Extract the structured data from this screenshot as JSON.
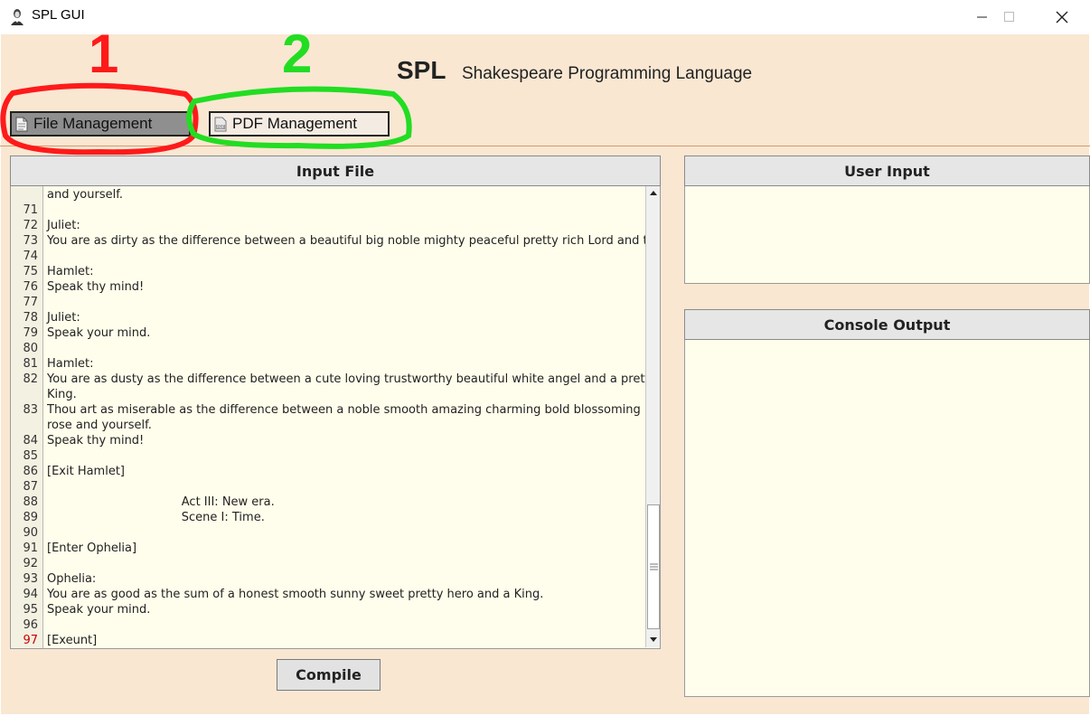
{
  "window": {
    "title": "SPL GUI"
  },
  "header": {
    "logo": "SPL",
    "subtitle": "Shakespeare Programming Language"
  },
  "tabs": [
    {
      "label": "File Management",
      "active": true
    },
    {
      "label": "PDF Management",
      "active": false
    }
  ],
  "annotations": {
    "marker1": "1",
    "marker2": "2",
    "color1": "#ff1a1a",
    "color2": "#22dd22"
  },
  "input_panel": {
    "title": "Input File",
    "lines": [
      {
        "n": "",
        "t": "and yourself."
      },
      {
        "n": "71",
        "t": ""
      },
      {
        "n": "72",
        "t": "Juliet:"
      },
      {
        "n": "73",
        "t": "You are as dirty as the difference between a beautiful big noble mighty peaceful pretty rich Lord and thyself."
      },
      {
        "n": "74",
        "t": ""
      },
      {
        "n": "75",
        "t": "Hamlet:"
      },
      {
        "n": "76",
        "t": "Speak thy mind!"
      },
      {
        "n": "77",
        "t": ""
      },
      {
        "n": "78",
        "t": "Juliet:"
      },
      {
        "n": "79",
        "t": "Speak your mind."
      },
      {
        "n": "80",
        "t": ""
      },
      {
        "n": "81",
        "t": "Hamlet:"
      },
      {
        "n": "82",
        "t": "You are as dusty as the difference between a cute loving trustworthy beautiful white angel and a pretty rich"
      },
      {
        "n": "",
        "t": "King."
      },
      {
        "n": "83",
        "t": "Thou art as miserable as the difference between a noble smooth amazing charming bold blossoming big"
      },
      {
        "n": "",
        "t": "rose and yourself."
      },
      {
        "n": "84",
        "t": "Speak thy mind!"
      },
      {
        "n": "85",
        "t": ""
      },
      {
        "n": "86",
        "t": "[Exit Hamlet]"
      },
      {
        "n": "87",
        "t": ""
      },
      {
        "n": "88",
        "t": "                                    Act III: New era."
      },
      {
        "n": "89",
        "t": "                                    Scene I: Time."
      },
      {
        "n": "90",
        "t": ""
      },
      {
        "n": "91",
        "t": "[Enter Ophelia]"
      },
      {
        "n": "92",
        "t": ""
      },
      {
        "n": "93",
        "t": "Ophelia:"
      },
      {
        "n": "94",
        "t": "You are as good as the sum of a honest smooth sunny sweet pretty hero and a King."
      },
      {
        "n": "95",
        "t": "Speak your mind."
      },
      {
        "n": "96",
        "t": ""
      },
      {
        "n": "97",
        "t": "[Exeunt]"
      }
    ]
  },
  "compile": {
    "label": "Compile"
  },
  "user_input": {
    "title": "User Input",
    "value": ""
  },
  "console": {
    "title": "Console Output",
    "value": ""
  },
  "colors": {
    "background": "#f9e7d2",
    "editor": "#fffdeb",
    "current_line_number": "#cc0000"
  }
}
